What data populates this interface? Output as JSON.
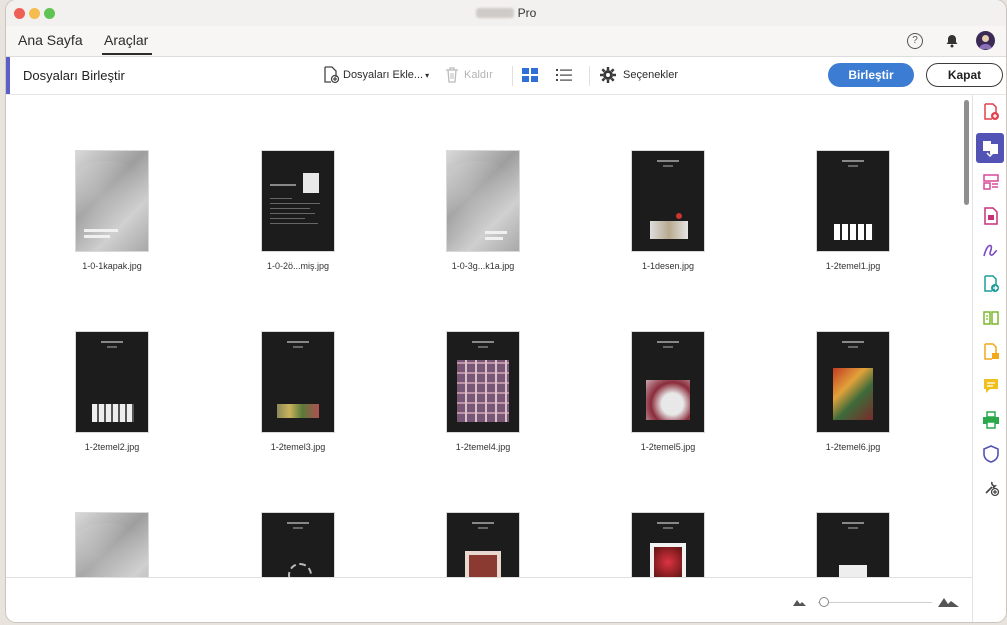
{
  "window": {
    "title": "Pro"
  },
  "tabs": {
    "home": "Ana Sayfa",
    "tools": "Araçlar"
  },
  "header_icons": [
    "help-icon",
    "bell-icon",
    "avatar"
  ],
  "toolbar": {
    "title": "Dosyaları Birleştir",
    "add_files": "Dosyaları Ekle...",
    "remove": "Kaldır",
    "options": "Seçenekler",
    "combine_button": "Birleştir",
    "close_button": "Kapat"
  },
  "files": [
    {
      "name": "1-0-1kapak.jpg"
    },
    {
      "name": "1-0-2ö...miş.jpg"
    },
    {
      "name": "1-0-3g...k1a.jpg"
    },
    {
      "name": "1-1desen.jpg"
    },
    {
      "name": "1-2temel1.jpg"
    },
    {
      "name": "1-2temel2.jpg"
    },
    {
      "name": "1-2temel3.jpg"
    },
    {
      "name": "1-2temel4.jpg"
    },
    {
      "name": "1-2temel5.jpg"
    },
    {
      "name": "1-2temel6.jpg"
    },
    {
      "name": ""
    },
    {
      "name": ""
    },
    {
      "name": ""
    },
    {
      "name": ""
    },
    {
      "name": ""
    }
  ],
  "right_panel": [
    "create-pdf-icon",
    "combine-files-icon",
    "organize-pages-icon",
    "compress-icon",
    "fill-sign-icon",
    "export-pdf-icon",
    "edit-pdf-icon",
    "send-for-review-icon",
    "comment-icon",
    "print-production-icon",
    "protect-icon",
    "more-tools-icon"
  ],
  "colors": {
    "accent": "#3c7cd3",
    "active_tool": "#5253b5",
    "toolbar_accent": "#5c5fc8"
  },
  "zoom": {
    "level": 0.05
  }
}
